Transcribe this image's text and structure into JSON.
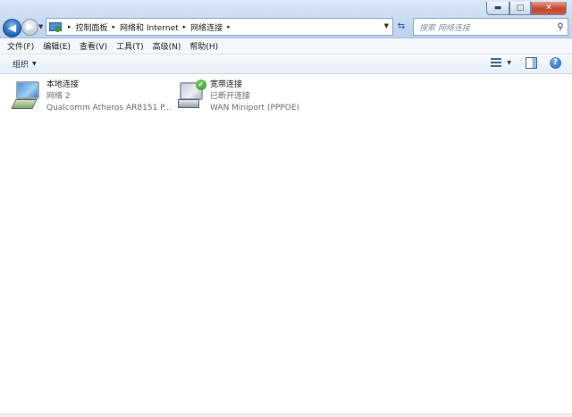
{
  "window": {
    "controls": {
      "minimize": "▬",
      "maximize": "□",
      "close": "✕"
    }
  },
  "nav": {
    "back_icon": "arrow-left-icon",
    "forward_icon": "arrow-right-icon"
  },
  "address": {
    "crumbs": [
      "控制面板",
      "网络和 Internet",
      "网络连接"
    ],
    "separator": "▸"
  },
  "search": {
    "placeholder": "搜索 网络连接"
  },
  "menu": {
    "items": [
      "文件(F)",
      "编辑(E)",
      "查看(V)",
      "工具(T)",
      "高级(N)",
      "帮助(H)"
    ]
  },
  "commandbar": {
    "organize": "组织"
  },
  "connections": [
    {
      "name": "本地连接",
      "status": "网络  2",
      "device": "Qualcomm Atheros AR8151 P...",
      "icon": "lan-adapter-icon"
    },
    {
      "name": "宽带连接",
      "status": "已断开连接",
      "device": "WAN Miniport (PPPOE)",
      "icon": "broadband-connection-icon"
    }
  ]
}
